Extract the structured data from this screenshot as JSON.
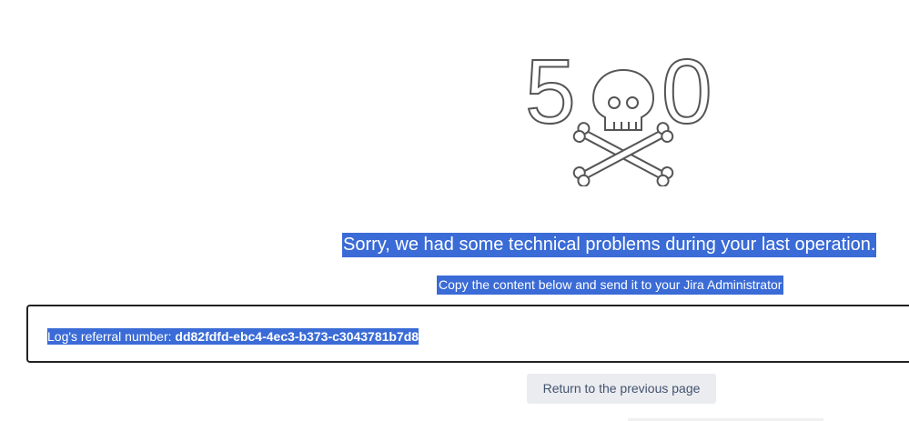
{
  "error": {
    "code_left": "5",
    "code_right": "0",
    "illustration_icon": "skull-crossbones-icon"
  },
  "message": {
    "headline": "Sorry, we had some technical problems during your last operation.",
    "instruction": "Copy the content below and send it to your Jira Administrator"
  },
  "log": {
    "label": "Log's referral number: ",
    "referral_number": "dd82fdfd-ebc4-4ec3-b373-c3043781b7d8"
  },
  "actions": {
    "return_label": "Return to the previous page"
  },
  "colors": {
    "selection": "#3a6bd6",
    "button_bg": "#ebecf0",
    "illustration_stroke": "#555555"
  }
}
